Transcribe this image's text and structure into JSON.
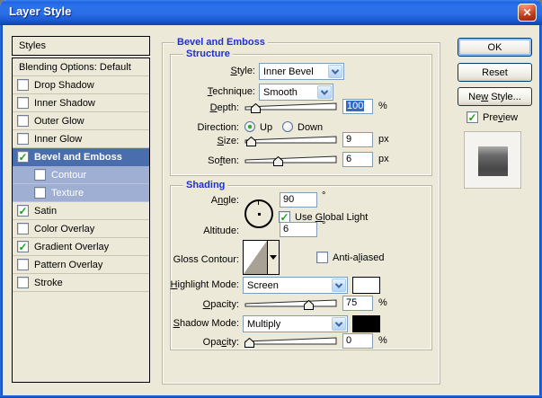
{
  "window": {
    "title": "Layer Style"
  },
  "icons": {
    "close": "✕",
    "check": "✓"
  },
  "sidebar": {
    "header": "Styles",
    "items": [
      {
        "label": "Blending Options: Default",
        "type": "plain"
      },
      {
        "label": "Drop Shadow",
        "checked": false
      },
      {
        "label": "Inner Shadow",
        "checked": false
      },
      {
        "label": "Outer Glow",
        "checked": false
      },
      {
        "label": "Inner Glow",
        "checked": false
      },
      {
        "label": "Bevel and Emboss",
        "checked": true,
        "selected": true
      },
      {
        "label": "Contour",
        "checked": false,
        "indented": true
      },
      {
        "label": "Texture",
        "checked": false,
        "indented": true
      },
      {
        "label": "Satin",
        "checked": true
      },
      {
        "label": "Color Overlay",
        "checked": false
      },
      {
        "label": "Gradient Overlay",
        "checked": true
      },
      {
        "label": "Pattern Overlay",
        "checked": false
      },
      {
        "label": "Stroke",
        "checked": false
      }
    ]
  },
  "panel": {
    "legend": "Bevel and Emboss",
    "structure": {
      "legend": "Structure",
      "style_label": {
        "pre": "",
        "key": "S",
        "post": "tyle:"
      },
      "style_value": "Inner Bevel",
      "technique_label": {
        "pre": "",
        "key": "T",
        "post": "echnique:"
      },
      "technique_value": "Smooth",
      "depth_label": {
        "pre": "",
        "key": "D",
        "post": "epth:"
      },
      "depth_value": "100",
      "depth_unit": "%",
      "depth_value_selected": true,
      "depth_thumb_style": "left:7px",
      "direction_label": "Direction:",
      "direction_up": "Up",
      "direction_down": "Down",
      "direction_selected": "Up",
      "size_label": {
        "pre": "",
        "key": "S",
        "post": "ize:"
      },
      "size_value": "9",
      "size_unit": "px",
      "size_thumb_style": "left:2px",
      "soften_label": {
        "pre": "So",
        "key": "f",
        "post": "ten:"
      },
      "soften_value": "6",
      "soften_unit": "px",
      "soften_thumb_style": "left:32px"
    },
    "shading": {
      "legend": "Shading",
      "angle_label": {
        "pre": "A",
        "key": "n",
        "post": "gle:"
      },
      "angle_value": "90",
      "angle_unit": "°",
      "global_light_label": {
        "pre": "Use ",
        "key": "G",
        "post": "lobal Light"
      },
      "global_light_checked": true,
      "altitude_label": "Altitude:",
      "altitude_value": "6",
      "altitude_unit": "°",
      "gloss_label": "Gloss Contour:",
      "anti_aliased_label": {
        "pre": "Anti-a",
        "key": "l",
        "post": "iased"
      },
      "anti_aliased_checked": false,
      "highlight_label": {
        "pre": "",
        "key": "H",
        "post": "ighlight Mode:"
      },
      "highlight_value": "Screen",
      "highlight_swatch_style": "background:#FFFFFF",
      "opacity1_label": {
        "pre": "",
        "key": "O",
        "post": "pacity:"
      },
      "opacity1_value": "75",
      "opacity1_unit": "%",
      "opacity1_thumb_style": "left:66px",
      "shadow_label": {
        "pre": "",
        "key": "S",
        "post": "hadow Mode:"
      },
      "shadow_value": "Multiply",
      "shadow_swatch_style": "background:#000000",
      "opacity2_label": {
        "pre": "Opa",
        "key": "c",
        "post": "ity:"
      },
      "opacity2_value": "0",
      "opacity2_unit": "%",
      "opacity2_thumb_style": "left:0px"
    }
  },
  "actions": {
    "ok": "OK",
    "reset": "Reset",
    "new_style": {
      "pre": "Ne",
      "key": "w",
      "post": " Style..."
    },
    "preview": {
      "pre": "Pre",
      "key": "v",
      "post": "iew"
    },
    "preview_checked": true
  },
  "colors": {
    "dialog_bg": "#ECE9D8",
    "titlebar_blue": "#2A6EE6",
    "selected_row": "#4A6DAD",
    "sub_row": "#9FAFD4",
    "selection_highlight": "#316AC5",
    "legend_blue": "#2030CC",
    "field_border": "#7F9DB9",
    "check_green": "#21A121"
  }
}
